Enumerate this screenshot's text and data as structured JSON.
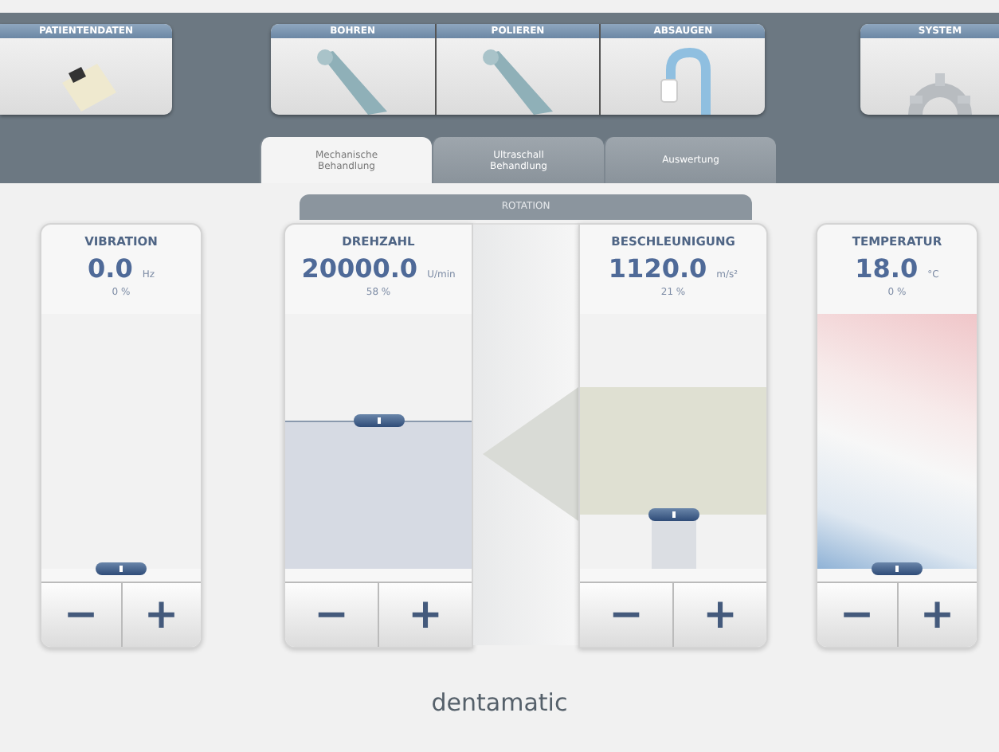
{
  "module_groups": [
    [
      {
        "label": "PATIENTENDATEN"
      }
    ],
    [
      {
        "label": "BOHREN"
      },
      {
        "label": "POLIEREN"
      },
      {
        "label": "ABSAUGEN"
      }
    ],
    [
      {
        "label": "SYSTEM"
      }
    ]
  ],
  "tabs": [
    {
      "label": "Mechanische Behandlung",
      "selected": true
    },
    {
      "label": "Ultraschall Behandlung",
      "selected": false
    },
    {
      "label": "Auswertung",
      "selected": false
    }
  ],
  "panels": [
    {
      "kind": "single",
      "meters": [
        {
          "kind": "plain",
          "name": "VIBRATION",
          "value": "0.0",
          "unit": "Hz",
          "percent": "0 %",
          "level": 0,
          "minus": "−",
          "plus": "+"
        }
      ]
    },
    {
      "kind": "group",
      "title": "ROTATION",
      "meters": [
        {
          "kind": "fill-below",
          "name": "DREHZAHL",
          "value": "20000.0",
          "unit": "U/min",
          "percent": "58 %",
          "level": 0.58,
          "minus": "−",
          "plus": "+"
        },
        {
          "kind": "fill-above",
          "name": "BESCHLEUNIGUNG",
          "value": "1120.0",
          "unit": "m/s²",
          "percent": "21 %",
          "level": 0.21,
          "minus": "−",
          "plus": "+"
        }
      ]
    },
    {
      "kind": "single",
      "meters": [
        {
          "kind": "gradient",
          "name": "TEMPERATUR",
          "value": "18.0",
          "unit": "°C",
          "percent": "0 %",
          "level": 0,
          "minus": "−",
          "plus": "+"
        }
      ]
    }
  ],
  "logo": "dentamatic"
}
